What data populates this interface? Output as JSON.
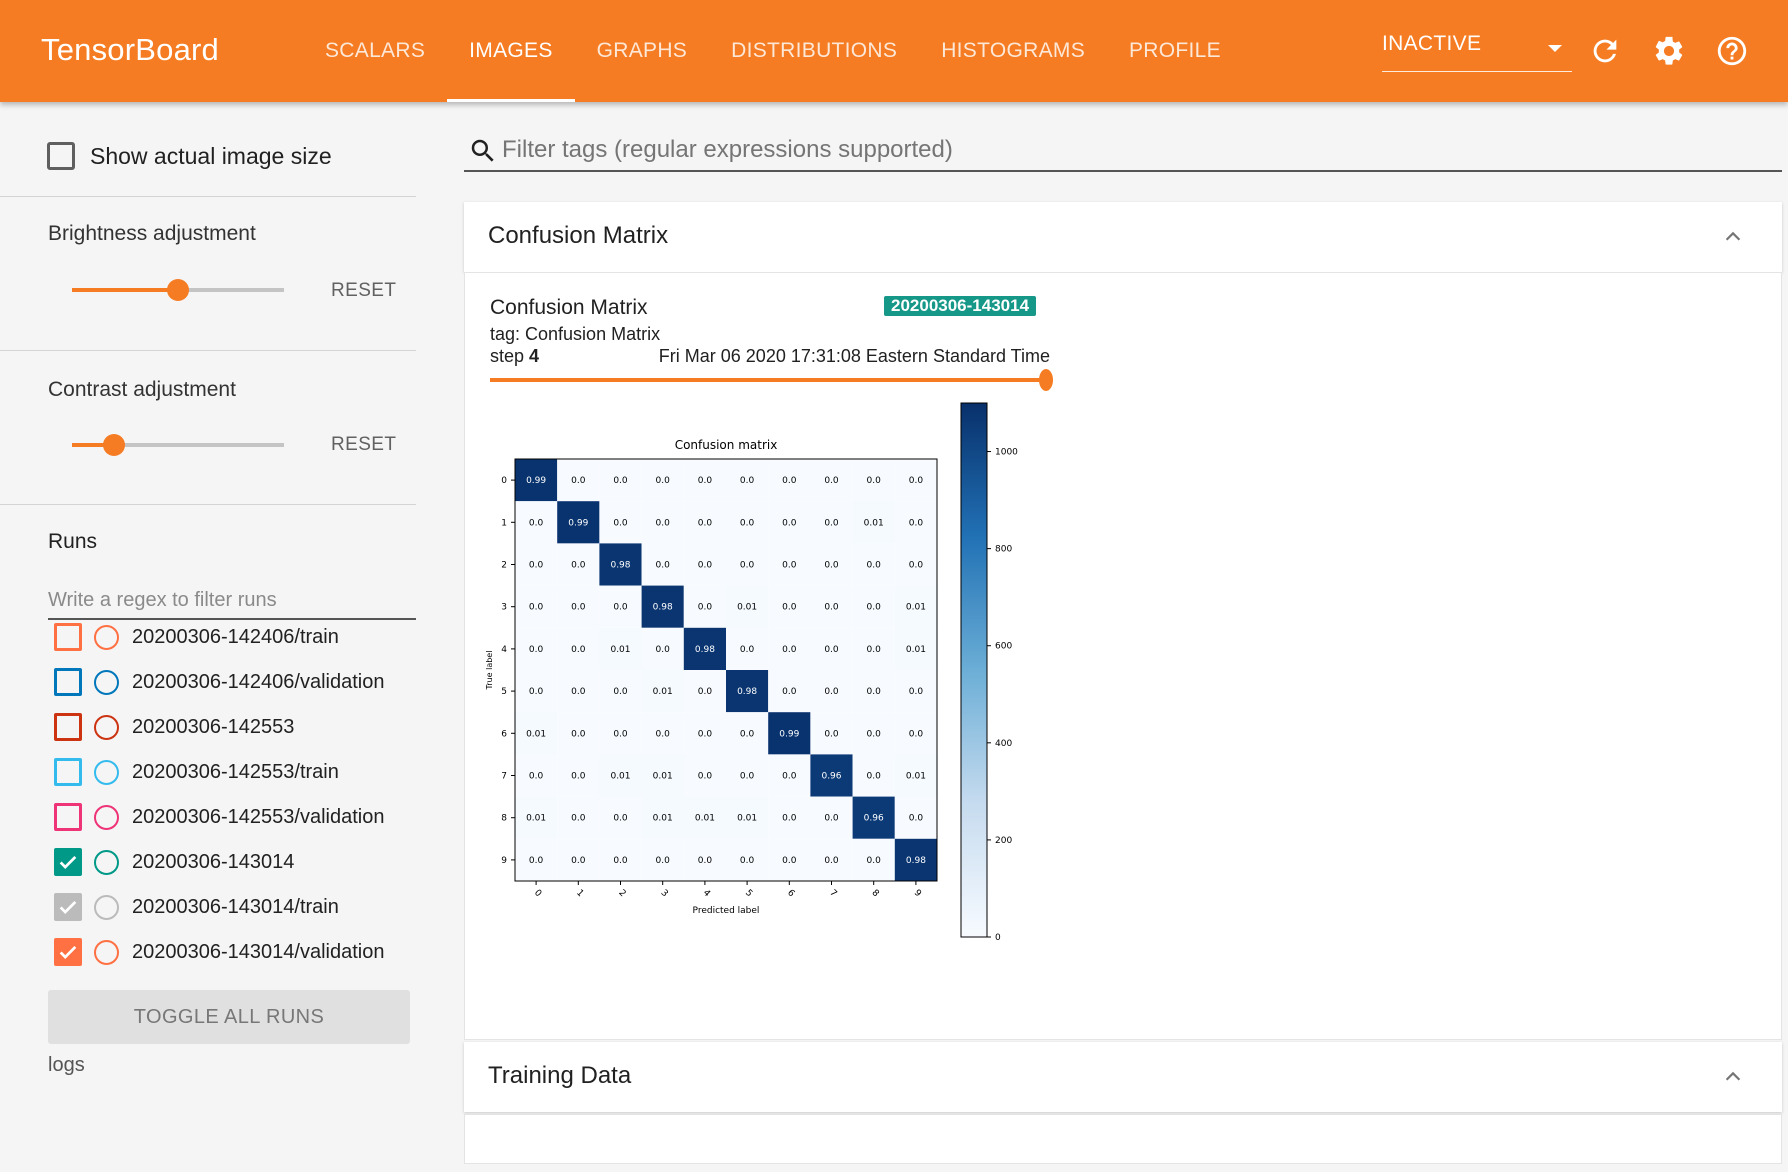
{
  "app": {
    "brand": "TensorBoard"
  },
  "nav": {
    "tabs": [
      "SCALARS",
      "IMAGES",
      "GRAPHS",
      "DISTRIBUTIONS",
      "HISTOGRAMS",
      "PROFILE"
    ],
    "active_tab": "IMAGES",
    "status_select": "INACTIVE",
    "icons": [
      "refresh-icon",
      "settings-gear-icon",
      "help-icon"
    ]
  },
  "sidebar": {
    "show_actual_size_label": "Show actual image size",
    "show_actual_size_checked": false,
    "brightness_label": "Brightness adjustment",
    "brightness_value": 0.5,
    "contrast_label": "Contrast adjustment",
    "contrast_value": 0.2,
    "reset_label": "RESET",
    "runs_heading": "Runs",
    "runs_filter_placeholder": "Write a regex to filter runs",
    "runs": [
      {
        "name": "20200306-142406/train",
        "color": "#ff7043",
        "checked": false
      },
      {
        "name": "20200306-142406/validation",
        "color": "#0077bb",
        "checked": false
      },
      {
        "name": "20200306-142553",
        "color": "#cc3311",
        "checked": false
      },
      {
        "name": "20200306-142553/train",
        "color": "#33bbee",
        "checked": false
      },
      {
        "name": "20200306-142553/validation",
        "color": "#ee3377",
        "checked": false
      },
      {
        "name": "20200306-143014",
        "color": "#009988",
        "checked": true
      },
      {
        "name": "20200306-143014/train",
        "color": "#bbbbbb",
        "checked": true
      },
      {
        "name": "20200306-143014/validation",
        "color": "#ff7043",
        "checked": true
      }
    ],
    "toggle_all_label": "TOGGLE ALL RUNS",
    "logdir": "logs"
  },
  "main": {
    "filter_placeholder": "Filter tags (regular expressions supported)",
    "sections": [
      {
        "title": "Confusion Matrix",
        "expanded": true
      },
      {
        "title": "Training Data",
        "expanded": true
      }
    ],
    "image_card": {
      "title": "Confusion Matrix",
      "run_chip": "20200306-143014",
      "tag": "tag: Confusion Matrix",
      "step_label": "step",
      "step_value": "4",
      "timestamp": "Fri Mar 06 2020 17:31:08 Eastern Standard Time",
      "step_position": 1.0
    }
  },
  "confusion_matrix": {
    "title": "Confusion matrix",
    "xlabel": "Predicted label",
    "ylabel": "True label",
    "labels": [
      "0",
      "1",
      "2",
      "3",
      "4",
      "5",
      "6",
      "7",
      "8",
      "9"
    ],
    "values": [
      [
        "0.99",
        "0.0",
        "0.0",
        "0.0",
        "0.0",
        "0.0",
        "0.0",
        "0.0",
        "0.0",
        "0.0"
      ],
      [
        "0.0",
        "0.99",
        "0.0",
        "0.0",
        "0.0",
        "0.0",
        "0.0",
        "0.0",
        "0.01",
        "0.0"
      ],
      [
        "0.0",
        "0.0",
        "0.98",
        "0.0",
        "0.0",
        "0.0",
        "0.0",
        "0.0",
        "0.0",
        "0.0"
      ],
      [
        "0.0",
        "0.0",
        "0.0",
        "0.98",
        "0.0",
        "0.01",
        "0.0",
        "0.0",
        "0.0",
        "0.01"
      ],
      [
        "0.0",
        "0.0",
        "0.01",
        "0.0",
        "0.98",
        "0.0",
        "0.0",
        "0.0",
        "0.0",
        "0.01"
      ],
      [
        "0.0",
        "0.0",
        "0.0",
        "0.01",
        "0.0",
        "0.98",
        "0.0",
        "0.0",
        "0.0",
        "0.0"
      ],
      [
        "0.01",
        "0.0",
        "0.0",
        "0.0",
        "0.0",
        "0.0",
        "0.99",
        "0.0",
        "0.0",
        "0.0"
      ],
      [
        "0.0",
        "0.0",
        "0.01",
        "0.01",
        "0.0",
        "0.0",
        "0.0",
        "0.96",
        "0.0",
        "0.01"
      ],
      [
        "0.01",
        "0.0",
        "0.0",
        "0.01",
        "0.01",
        "0.01",
        "0.0",
        "0.0",
        "0.96",
        "0.0"
      ],
      [
        "0.0",
        "0.0",
        "0.0",
        "0.0",
        "0.0",
        "0.0",
        "0.0",
        "0.0",
        "0.0",
        "0.98"
      ]
    ],
    "colorbar_ticks": [
      "0",
      "200",
      "400",
      "600",
      "800",
      "1000"
    ],
    "colorbar_max": 1100
  }
}
